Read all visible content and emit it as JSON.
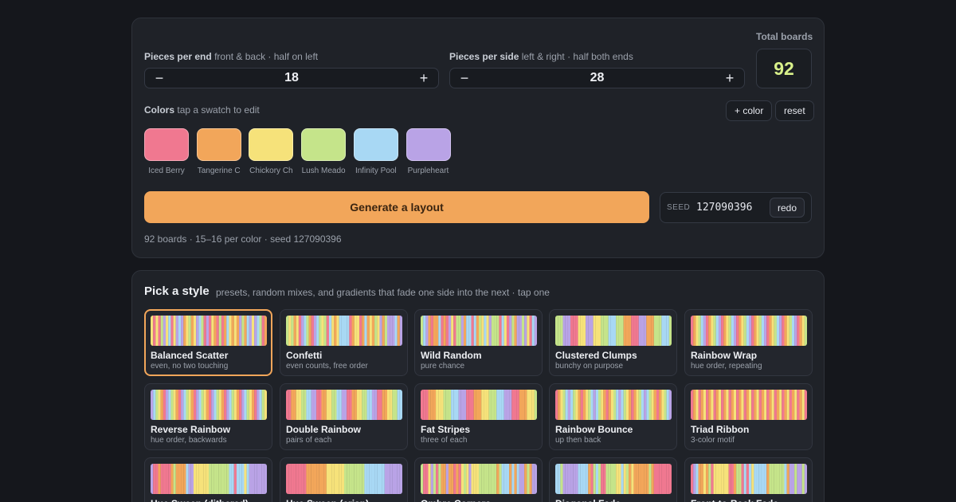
{
  "config": {
    "ends_label": "Pieces per end",
    "ends_hint": "front & back · half on left",
    "ends_value": "18",
    "sides_label": "Pieces per side",
    "sides_hint": "left & right · half both ends",
    "sides_value": "28",
    "minus": "−",
    "plus": "+",
    "total_label": "Total boards",
    "total_value": "92",
    "colors_label": "Colors",
    "colors_hint": "tap a swatch to edit",
    "add_color": "+ color",
    "reset": "reset",
    "swatches": [
      {
        "name": "Iced Berry",
        "color": "#f07890"
      },
      {
        "name": "Tangerine C",
        "color": "#f2a65a"
      },
      {
        "name": "Chickory Ch",
        "color": "#f6e27a"
      },
      {
        "name": "Lush Meado",
        "color": "#c5e48a"
      },
      {
        "name": "Infinity Pool",
        "color": "#a8d8f4"
      },
      {
        "name": "Purpleheart",
        "color": "#b9a3e6"
      }
    ],
    "generate": "Generate a layout",
    "seed_label": "SEED",
    "seed_value": "127090396",
    "redo": "redo",
    "summary": "92 boards · 15–16 per color · seed 127090396"
  },
  "styles": {
    "title": "Pick a style",
    "subtitle": "presets, random mixes, and gradients that fade one side into the next · tap one",
    "selected": 0,
    "cards": [
      {
        "name": "Balanced Scatter",
        "desc": "even, no two touching"
      },
      {
        "name": "Confetti",
        "desc": "even counts, free order"
      },
      {
        "name": "Wild Random",
        "desc": "pure chance"
      },
      {
        "name": "Clustered Clumps",
        "desc": "bunchy on purpose"
      },
      {
        "name": "Rainbow Wrap",
        "desc": "hue order, repeating"
      },
      {
        "name": "Reverse Rainbow",
        "desc": "hue order, backwards"
      },
      {
        "name": "Double Rainbow",
        "desc": "pairs of each"
      },
      {
        "name": "Fat Stripes",
        "desc": "three of each"
      },
      {
        "name": "Rainbow Bounce",
        "desc": "up then back"
      },
      {
        "name": "Triad Ribbon",
        "desc": "3-color motif"
      },
      {
        "name": "Hue Sweep (dithered)",
        "desc": ""
      },
      {
        "name": "Hue Sweep (crisp)",
        "desc": ""
      },
      {
        "name": "Ombre Corners",
        "desc": ""
      },
      {
        "name": "Diagonal Fade",
        "desc": ""
      },
      {
        "name": "Front-to-Back Fade",
        "desc": ""
      }
    ]
  }
}
